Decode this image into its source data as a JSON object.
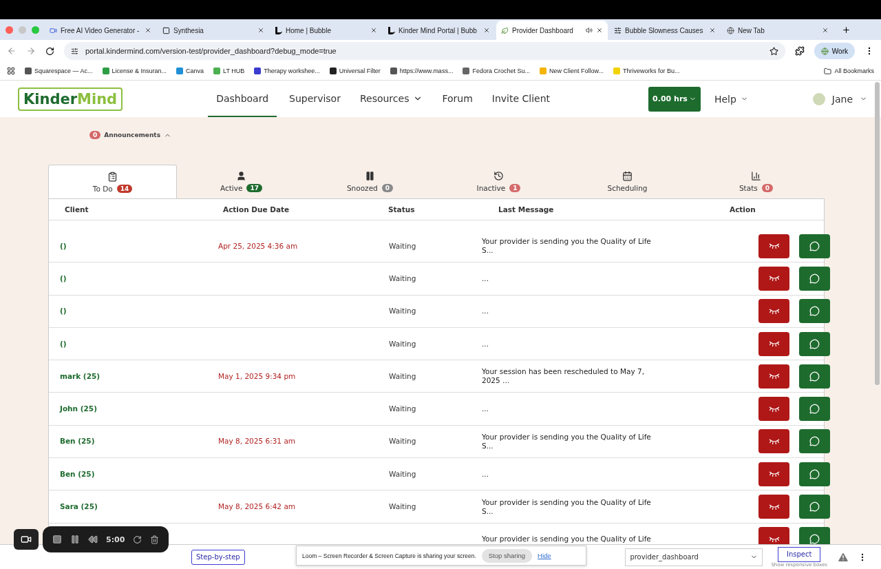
{
  "browser": {
    "tabs": [
      {
        "title": "Free AI Video Generator -",
        "selected": false,
        "kind": "video"
      },
      {
        "title": "Synthesia",
        "selected": false,
        "kind": "square"
      },
      {
        "title": "Home | Bubble",
        "selected": false,
        "kind": "bubble"
      },
      {
        "title": "Kinder Mind Portal | Bubb",
        "selected": false,
        "kind": "bubble"
      },
      {
        "title": "Provider Dashboard",
        "selected": true,
        "kind": "leaf"
      },
      {
        "title": "Bubble Slowness Causes",
        "selected": false,
        "kind": "ai"
      },
      {
        "title": "New Tab",
        "selected": false,
        "kind": "globe"
      }
    ],
    "url": "portal.kindermind.com/version-test/provider_dashboard?debug_mode=true",
    "profile": "Work",
    "bookmarks": [
      "Squarespace — Ac...",
      "License & Insuran...",
      "Canva",
      "LT HUB",
      "Therapy workshee...",
      "Universal Filter",
      "https://www.mass...",
      "Fedora Crochet Su...",
      "New Client Follow...",
      "Thriveworks for Bu..."
    ],
    "all_bookmarks": "All Bookmarks"
  },
  "header": {
    "logo": [
      "Kinder",
      "Mind"
    ],
    "nav": [
      {
        "label": "Dashboard",
        "selected": true,
        "dropdown": false
      },
      {
        "label": "Supervisor",
        "selected": false,
        "dropdown": false
      },
      {
        "label": "Resources",
        "selected": false,
        "dropdown": true
      },
      {
        "label": "Forum",
        "selected": false,
        "dropdown": false
      },
      {
        "label": "Invite Client",
        "selected": false,
        "dropdown": false
      }
    ],
    "hours": "0.00 hrs",
    "help": "Help",
    "user": "Jane"
  },
  "announcements": {
    "count": "0",
    "label": "Announcements",
    "expanded": true
  },
  "tabs": [
    {
      "label": "To Do",
      "count": "14",
      "color": "#c0392b",
      "selected": true
    },
    {
      "label": "Active",
      "count": "17",
      "color": "#1e6b2e",
      "selected": false
    },
    {
      "label": "Snoozed",
      "count": "0",
      "color": "#8a8a8a",
      "selected": false
    },
    {
      "label": "Inactive",
      "count": "1",
      "color": "#d46a6a",
      "selected": false
    },
    {
      "label": "Scheduling",
      "selected": false
    },
    {
      "label": "Stats",
      "count": "0",
      "color": "#d46a6a",
      "selected": false
    }
  ],
  "table": {
    "columns": [
      "Client",
      "Action Due Date",
      "Status",
      "Last Message",
      "Action"
    ],
    "rows": [
      {
        "client": "()",
        "due": "Apr 25, 2025 4:36 am",
        "status": "Waiting",
        "message": "Your provider is sending you the Quality of Life S..."
      },
      {
        "client": "()",
        "status": "Waiting",
        "message": "..."
      },
      {
        "client": "()",
        "status": "Waiting",
        "message": "..."
      },
      {
        "client": "()",
        "status": "Waiting",
        "message": "..."
      },
      {
        "client": "mark (25)",
        "due": "May 1, 2025 9:34 pm",
        "status": "Waiting",
        "message": "Your  session has been rescheduled to May 7, 2025 ..."
      },
      {
        "client": "John (25)",
        "status": "Waiting",
        "message": "..."
      },
      {
        "client": "Ben (25)",
        "due": "May 8, 2025 6:31 am",
        "status": "Waiting",
        "message": "Your provider is sending you the Quality of Life S..."
      },
      {
        "client": "Ben (25)",
        "status": "Waiting",
        "message": "..."
      },
      {
        "client": "Sara (25)",
        "due": "May 8, 2025 6:42 am",
        "status": "Waiting",
        "message": "Your provider is sending you the Quality of Life S..."
      },
      {
        "message": "Your provider is sending you the Quality of Life"
      }
    ]
  },
  "debugger": {
    "step": "Step-by-step",
    "page": "provider_dashboard",
    "inspect": "Inspect",
    "hint": "Show responsive boxes"
  },
  "recorder": {
    "time": "5:00"
  },
  "loom": {
    "text": "Loom – Screen Recorder & Screen Capture is sharing your screen.",
    "stop": "Stop sharing",
    "hide": "Hide"
  }
}
